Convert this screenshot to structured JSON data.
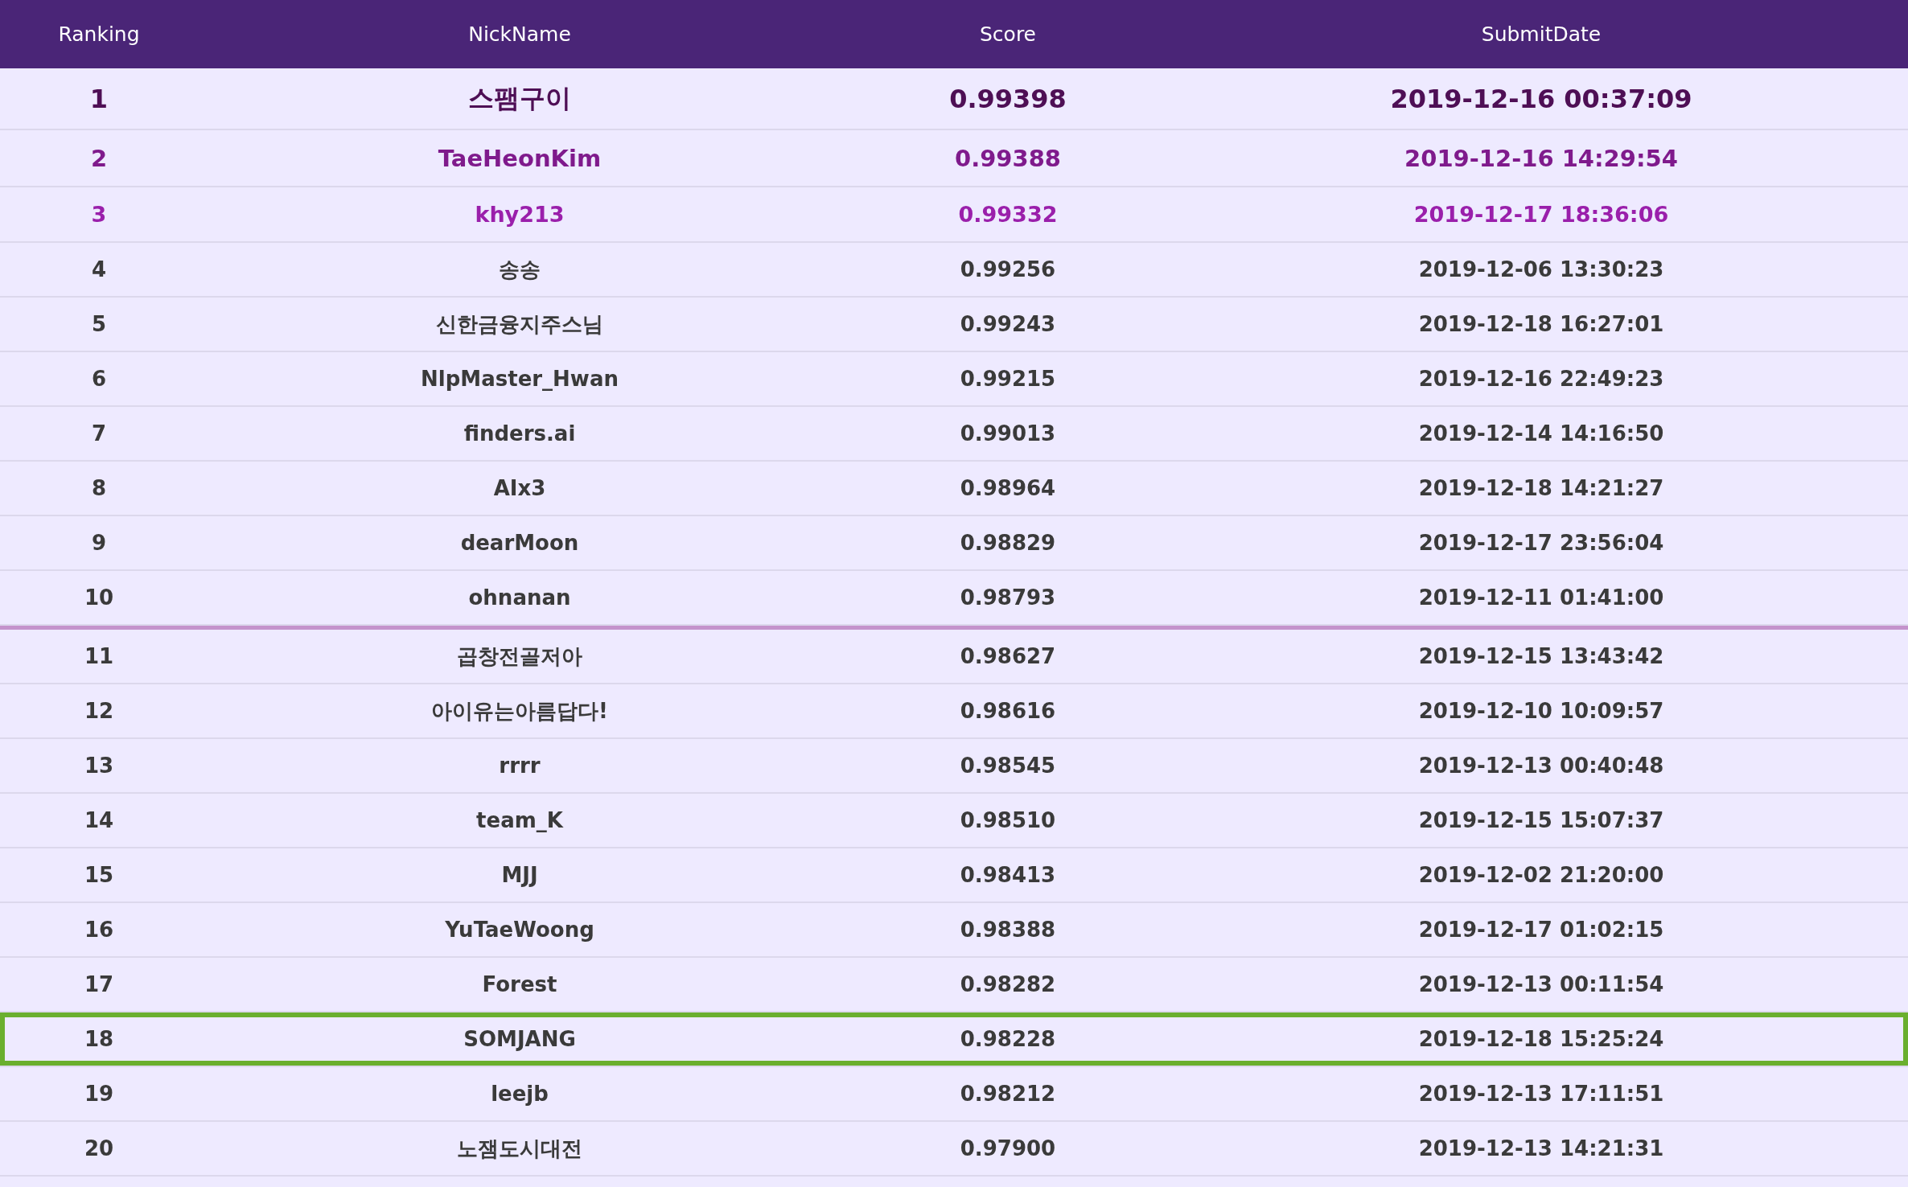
{
  "table": {
    "columns": [
      "Ranking",
      "NickName",
      "Score",
      "SubmitDate"
    ],
    "groups": [
      {
        "rows": [
          {
            "kind": "first",
            "highlighted": false,
            "cells": [
              "1",
              "스팸구이",
              "0.99398",
              "2019-12-16 00:37:09"
            ]
          },
          {
            "kind": "second",
            "highlighted": false,
            "cells": [
              "2",
              "TaeHeonKim",
              "0.99388",
              "2019-12-16 14:29:54"
            ]
          },
          {
            "kind": "third",
            "highlighted": false,
            "cells": [
              "3",
              "khy213",
              "0.99332",
              "2019-12-17 18:36:06"
            ]
          },
          {
            "kind": "normal",
            "highlighted": false,
            "cells": [
              "4",
              "송송",
              "0.99256",
              "2019-12-06 13:30:23"
            ]
          },
          {
            "kind": "normal",
            "highlighted": false,
            "cells": [
              "5",
              "신한금융지주스님",
              "0.99243",
              "2019-12-18 16:27:01"
            ]
          },
          {
            "kind": "normal",
            "highlighted": false,
            "cells": [
              "6",
              "NlpMaster_Hwan",
              "0.99215",
              "2019-12-16 22:49:23"
            ]
          },
          {
            "kind": "normal",
            "highlighted": false,
            "cells": [
              "7",
              "finders.ai",
              "0.99013",
              "2019-12-14 14:16:50"
            ]
          },
          {
            "kind": "normal",
            "highlighted": false,
            "cells": [
              "8",
              "AIx3",
              "0.98964",
              "2019-12-18 14:21:27"
            ]
          },
          {
            "kind": "normal",
            "highlighted": false,
            "cells": [
              "9",
              "dearMoon",
              "0.98829",
              "2019-12-17 23:56:04"
            ]
          },
          {
            "kind": "normal",
            "highlighted": false,
            "cells": [
              "10",
              "ohnanan",
              "0.98793",
              "2019-12-11 01:41:00"
            ]
          }
        ]
      },
      {
        "rows": [
          {
            "kind": "normal",
            "highlighted": false,
            "cells": [
              "11",
              "곱창전골저아",
              "0.98627",
              "2019-12-15 13:43:42"
            ]
          },
          {
            "kind": "normal",
            "highlighted": false,
            "cells": [
              "12",
              "아이유는아름답다!",
              "0.98616",
              "2019-12-10 10:09:57"
            ]
          },
          {
            "kind": "normal",
            "highlighted": false,
            "cells": [
              "13",
              "rrrr",
              "0.98545",
              "2019-12-13 00:40:48"
            ]
          },
          {
            "kind": "normal",
            "highlighted": false,
            "cells": [
              "14",
              "team_K",
              "0.98510",
              "2019-12-15 15:07:37"
            ]
          },
          {
            "kind": "normal",
            "highlighted": false,
            "cells": [
              "15",
              "MJJ",
              "0.98413",
              "2019-12-02 21:20:00"
            ]
          },
          {
            "kind": "normal",
            "highlighted": false,
            "cells": [
              "16",
              "YuTaeWoong",
              "0.98388",
              "2019-12-17 01:02:15"
            ]
          },
          {
            "kind": "normal",
            "highlighted": false,
            "cells": [
              "17",
              "Forest",
              "0.98282",
              "2019-12-13 00:11:54"
            ]
          },
          {
            "kind": "normal",
            "highlighted": true,
            "cells": [
              "18",
              "SOMJANG",
              "0.98228",
              "2019-12-18 15:25:24"
            ]
          },
          {
            "kind": "normal",
            "highlighted": false,
            "cells": [
              "19",
              "leejb",
              "0.98212",
              "2019-12-13 17:11:51"
            ]
          },
          {
            "kind": "normal",
            "highlighted": false,
            "cells": [
              "20",
              "노잼도시대전",
              "0.97900",
              "2019-12-13 14:21:31"
            ]
          }
        ]
      }
    ]
  }
}
